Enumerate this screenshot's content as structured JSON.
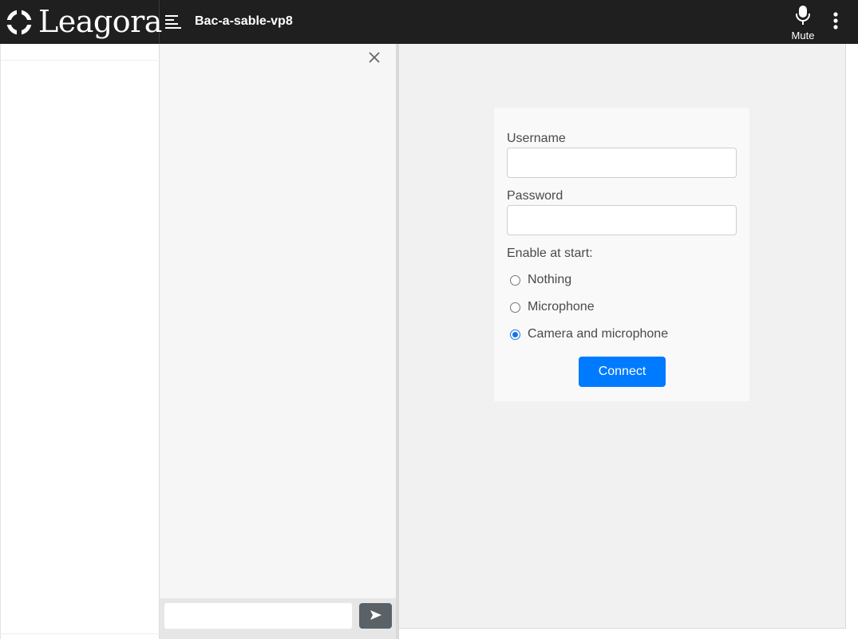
{
  "header": {
    "brand": "Leagora",
    "room_title": "Bac-a-sable-vp8",
    "mute_label": "Mute",
    "icons": {
      "logo": "leagora-logo-icon",
      "menu": "hamburger-menu-icon",
      "mic": "microphone-icon",
      "more": "vertical-dots-icon"
    }
  },
  "chat": {
    "input_value": "",
    "icons": {
      "close": "close-icon",
      "send": "send-arrow-icon"
    }
  },
  "login": {
    "username_label": "Username",
    "username_value": "",
    "password_label": "Password",
    "password_value": "",
    "enable_label": "Enable at start:",
    "options": [
      {
        "label": "Nothing",
        "checked": false
      },
      {
        "label": "Microphone",
        "checked": false
      },
      {
        "label": "Camera and microphone",
        "checked": true
      }
    ],
    "connect_label": "Connect"
  },
  "colors": {
    "topbar": "#1f1f1f",
    "accent": "#007bff",
    "send_button": "#5a6268",
    "chat_bg": "#f6f6f6",
    "main_bg": "#f1f1f1"
  }
}
